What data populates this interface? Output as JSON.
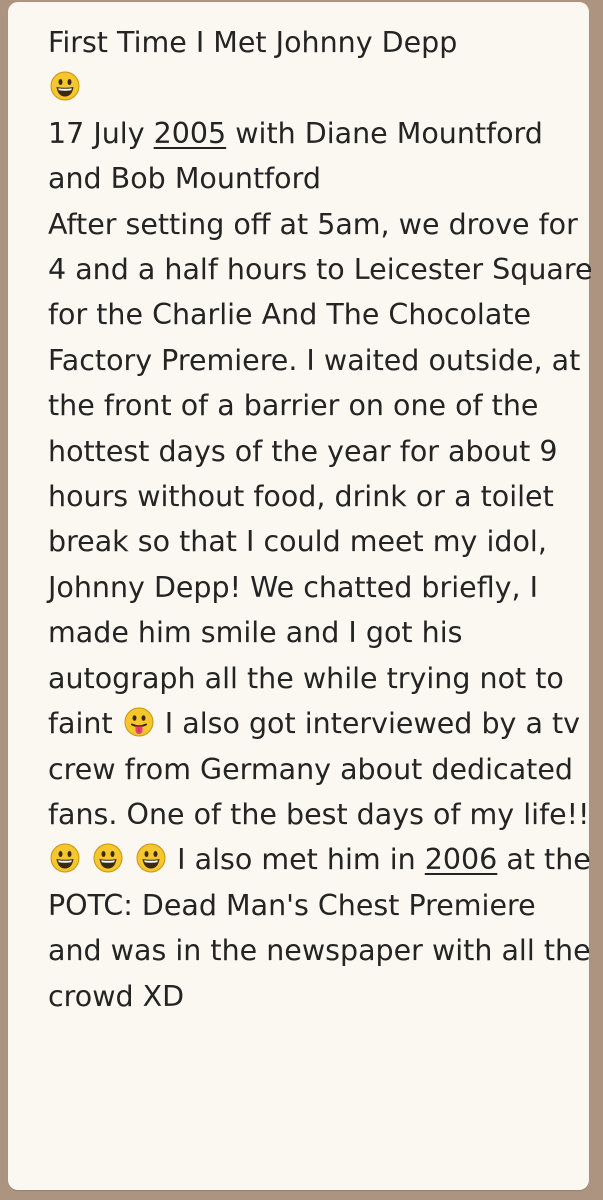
{
  "message": {
    "title": "First Time I Met Johnny Depp",
    "line_date_pre": "17 July ",
    "year_2005": "2005",
    "line_date_post": " with Diane Mountford and Bob Mountford",
    "body_part1": "After setting off at 5am, we drove for 4 and a half hours to Leicester Square for the Charlie And The Chocolate Factory Premiere. I waited outside, at the front of a barrier on one of the hottest days of the year for about 9 hours without food, drink or a toilet break so that I could meet my idol, Johnny Depp! We chatted briefly, I made him smile and I got his autograph all the while trying not to faint ",
    "body_part2": " I also got interviewed by a tv crew from Germany about dedicated fans. One of the best days of my life!! ",
    "body_part3": " I also met him in ",
    "year_2006": "2006",
    "body_part4": " at the POTC: Dead Man's Chest Premiere and was in the newspaper with all the crowd XD"
  },
  "icons": {
    "grin": "grinning-face-emoji",
    "tongue": "face-with-tongue-emoji"
  },
  "colors": {
    "background": "#ad9480",
    "bubble": "#fbf8f1",
    "text": "#242424",
    "emoji_yellow": "#f6c62d"
  }
}
